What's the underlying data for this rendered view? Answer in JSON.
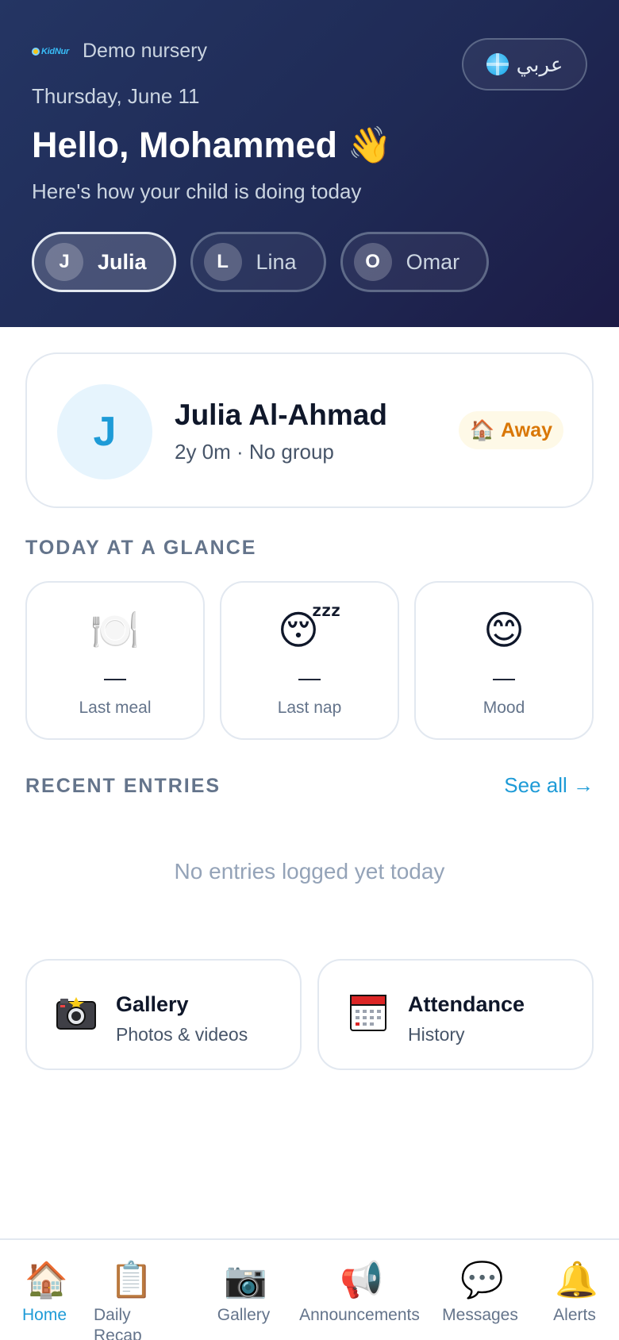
{
  "header": {
    "logo_text": "KidNur",
    "nursery_name": "Demo nursery",
    "language_button": "عربي",
    "date": "Thursday, June 11",
    "greeting": "Hello, Mohammed 👋",
    "subtitle": "Here's how your child is doing today"
  },
  "children": [
    {
      "initial": "J",
      "name": "Julia",
      "active": true
    },
    {
      "initial": "L",
      "name": "Lina",
      "active": false
    },
    {
      "initial": "O",
      "name": "Omar",
      "active": false
    }
  ],
  "child_card": {
    "initial": "J",
    "name": "Julia Al-Ahmad",
    "meta": "2y 0m · No group",
    "status_icon": "🏠",
    "status_label": "Away"
  },
  "glance": {
    "title": "TODAY AT A GLANCE",
    "items": [
      {
        "icon": "🍽️",
        "icon_name": "meal-icon",
        "value": "—",
        "label": "Last meal"
      },
      {
        "icon": "😴",
        "icon_name": "nap-icon",
        "value": "—",
        "label": "Last nap"
      },
      {
        "icon": "😊",
        "icon_name": "mood-icon",
        "value": "—",
        "label": "Mood"
      }
    ]
  },
  "recent": {
    "title": "RECENT ENTRIES",
    "see_all": "See all →",
    "empty": "No entries logged yet today"
  },
  "quick_links": [
    {
      "title": "Gallery",
      "subtitle": "Photos & videos",
      "icon_name": "camera-icon"
    },
    {
      "title": "Attendance",
      "subtitle": "History",
      "icon_name": "calendar-icon"
    }
  ],
  "nav": [
    {
      "label": "Home",
      "icon": "🏠",
      "active": true
    },
    {
      "label": "Daily Recap",
      "icon": "📋",
      "active": false
    },
    {
      "label": "Gallery",
      "icon": "📷",
      "active": false
    },
    {
      "label": "Announcements",
      "icon": "📢",
      "active": false
    },
    {
      "label": "Messages",
      "icon": "💬",
      "active": false
    },
    {
      "label": "Alerts",
      "icon": "🔔",
      "active": false
    }
  ],
  "colors": {
    "accent": "#1e9bd7",
    "header_start": "#243563",
    "header_end": "#1c1b46",
    "away": "#d97706"
  }
}
